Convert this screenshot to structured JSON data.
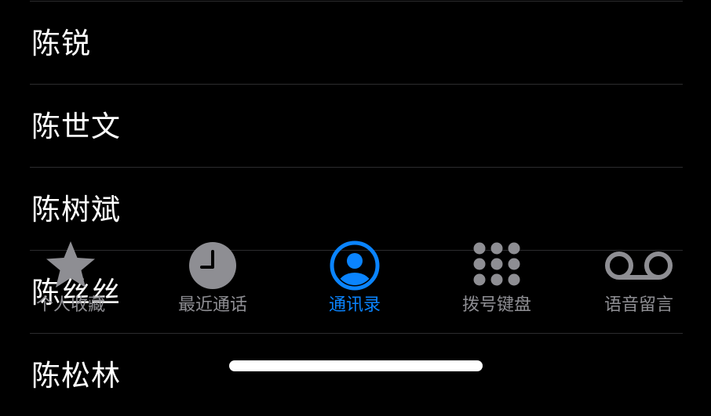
{
  "contacts": [
    {
      "name": "陈锐"
    },
    {
      "name": "陈世文"
    },
    {
      "name": "陈树斌"
    },
    {
      "name": "陈丝丝"
    },
    {
      "name": "陈松林"
    }
  ],
  "tabs": [
    {
      "label": "个人收藏",
      "icon": "star-icon",
      "active": false
    },
    {
      "label": "最近通话",
      "icon": "clock-icon",
      "active": false
    },
    {
      "label": "通讯录",
      "icon": "person-circle-icon",
      "active": true
    },
    {
      "label": "拨号键盘",
      "icon": "keypad-icon",
      "active": false
    },
    {
      "label": "语音留言",
      "icon": "voicemail-icon",
      "active": false
    }
  ],
  "colors": {
    "background": "#000000",
    "active_tab": "#0a84ff",
    "inactive_tab": "#8e8e93",
    "separator": "#2c2c2e"
  }
}
